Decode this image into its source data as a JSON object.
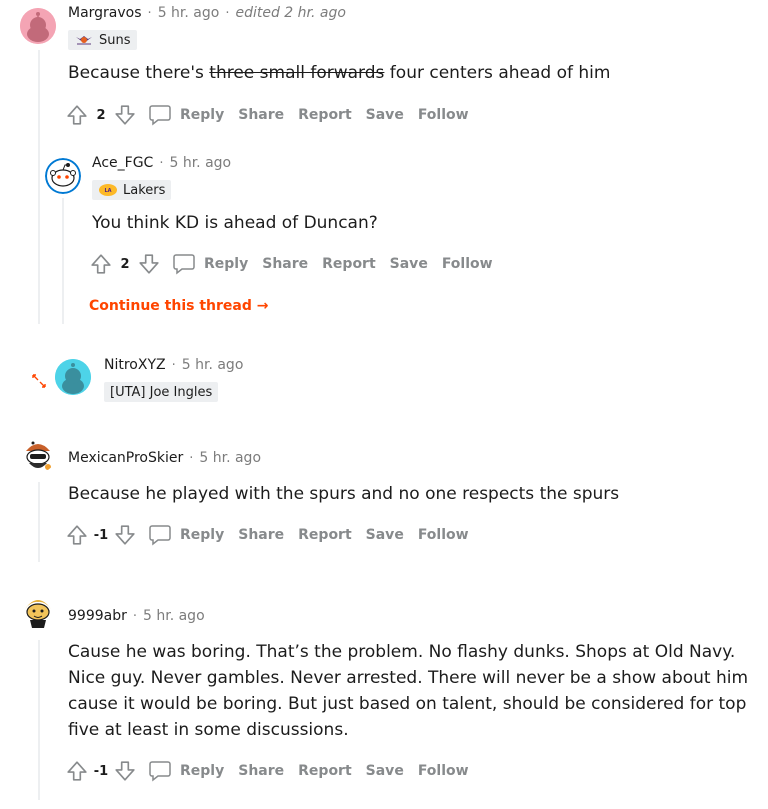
{
  "comments": [
    {
      "author": "Margravos",
      "time": "5 hr. ago",
      "edited": "edited 2 hr. ago",
      "flair": "Suns",
      "body_struck": "three small forwards",
      "body_prefix": "Because there's ",
      "body_suffix": " four centers ahead of him",
      "score": "2"
    },
    {
      "author": "Ace_FGC",
      "time": "5 hr. ago",
      "flair": "Lakers",
      "body": "You think KD is ahead of Duncan?",
      "score": "2",
      "continue_label": "Continue this thread"
    },
    {
      "author": "NitroXYZ",
      "time": "5 hr. ago",
      "flair": "[UTA] Joe Ingles"
    },
    {
      "author": "MexicanProSkier",
      "time": "5 hr. ago",
      "body": "Because he played with the spurs and no one respects the spurs",
      "score": "-1"
    },
    {
      "author": "9999abr",
      "time": "5 hr. ago",
      "body_lines": [
        "Cause he was boring. That’s the problem. No flashy dunks. Shops at Old Navy.",
        "Nice guy. Never gambles. Never arrested. There will never be a show about him",
        "cause it would be boring. But just based on talent, should be considered for top",
        "five at least in some discussions."
      ],
      "score": "-1"
    }
  ],
  "actions": {
    "reply": "Reply",
    "share": "Share",
    "report": "Report",
    "save": "Save",
    "follow": "Follow"
  },
  "colors": {
    "accent": "#ff4500",
    "meta_gray": "#7c7c7c",
    "action_gray": "#878a8c",
    "flair_bg": "#edeff1",
    "thread_line": "#edeff1"
  },
  "icons": [
    "upvote-icon",
    "downvote-icon",
    "reply-icon",
    "expand-icon",
    "arrow-right-icon",
    "suns-logo-icon",
    "lakers-logo-icon"
  ]
}
